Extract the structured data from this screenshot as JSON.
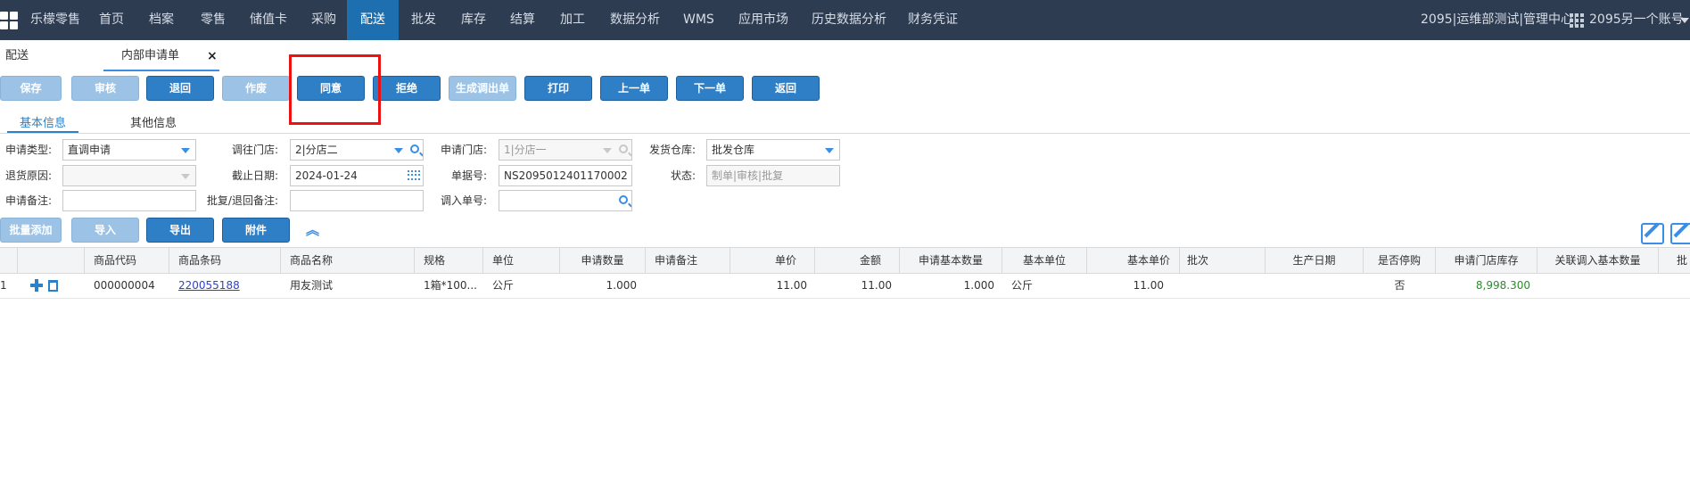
{
  "nav": {
    "brand": "乐檬零售",
    "items": [
      "首页",
      "档案",
      "零售",
      "储值卡",
      "采购",
      "配送",
      "批发",
      "库存",
      "结算",
      "加工",
      "数据分析",
      "WMS",
      "应用市场",
      "历史数据分析",
      "财务凭证"
    ],
    "active": "配送",
    "org": "2095|运维部测试|管理中心|",
    "account": "2095另一个账号"
  },
  "tabs": {
    "first": "配送",
    "current": "内部申请单",
    "close": "×"
  },
  "toolbar": {
    "save": "保存",
    "audit": "审核",
    "return": "退回",
    "void": "作废",
    "agree": "同意",
    "reject": "拒绝",
    "gen_out": "生成调出单",
    "print": "打印",
    "prev": "上一单",
    "next": "下一单",
    "back": "返回"
  },
  "subtabs": {
    "basic": "基本信息",
    "other": "其他信息"
  },
  "form": {
    "apply_type_label": "申请类型:",
    "apply_type": "直调申请",
    "to_store_label": "调往门店:",
    "to_store": "2|分店二",
    "apply_store_label": "申请门店:",
    "apply_store": "1|分店一",
    "warehouse_label": "发货仓库:",
    "warehouse": "批发仓库",
    "return_reason_label": "退货原因:",
    "return_reason": "",
    "deadline_label": "截止日期:",
    "deadline": "2024-01-24",
    "order_no_label": "单据号:",
    "order_no": "NS2095012401170002",
    "status_label": "状态:",
    "status": "制单|审核|批复",
    "remark_label": "申请备注:",
    "remark": "",
    "reply_remark_label": "批复/退回备注:",
    "reply_remark": "",
    "in_no_label": "调入单号:",
    "in_no": ""
  },
  "itemtools": {
    "batch_add": "批量添加",
    "import": "导入",
    "export": "导出",
    "attach": "附件"
  },
  "table": {
    "columns": [
      "商品代码",
      "商品条码",
      "商品名称",
      "规格",
      "单位",
      "申请数量",
      "申请备注",
      "单价",
      "金额",
      "申请基本数量",
      "基本单位",
      "基本单价",
      "批次",
      "生产日期",
      "是否停购",
      "申请门店库存",
      "关联调入基本数量",
      "批"
    ],
    "rows": [
      {
        "index": "1",
        "code": "000000004",
        "barcode": "220055188",
        "name": "用友测试",
        "spec": "1箱*100...",
        "unit": "公斤",
        "qty": "1.000",
        "remark": "",
        "price": "11.00",
        "amount": "11.00",
        "base_qty": "1.000",
        "base_unit": "公斤",
        "base_price": "11.00",
        "batch": "",
        "prod_date": "",
        "stopped": "否",
        "stock": "8,998.300",
        "linked_qty": ""
      }
    ]
  },
  "colors": {
    "nav_bg": "#2e3c51",
    "nav_active": "#1e6fb0",
    "button": "#2f7fc7",
    "button_disabled": "#9cc3e6",
    "highlight_box": "#ee1111",
    "stock_text": "#2e8b2e"
  }
}
